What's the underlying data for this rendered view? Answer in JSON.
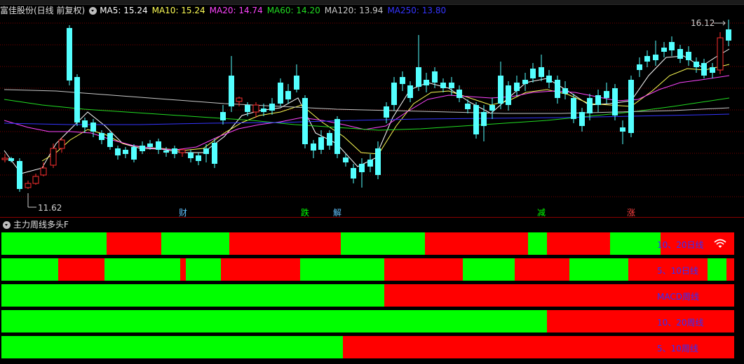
{
  "main_header": {
    "stock_name": "富佳股份(日线 前复权)",
    "ma5": "MA5: 15.24",
    "ma10": "MA10: 15.24",
    "ma20": "MA20: 14.74",
    "ma60": "MA60: 14.20",
    "ma120": "MA120: 13.94",
    "ma250": "MA250: 13.80"
  },
  "colors": {
    "up": "#ff3030",
    "down": "#54ffff",
    "ma5": "#ffffff",
    "ma10": "#ffff55",
    "ma20": "#ff44ff",
    "ma60": "#22dd22",
    "ma120": "#c8c8c8",
    "ma250": "#3535ff",
    "bar_green": "#00ff00",
    "bar_red": "#ff0000",
    "label_blue": "#3030ff",
    "grid": "#7a0000"
  },
  "price_labels": {
    "high": "16.12",
    "low": "11.62"
  },
  "annotations": [
    {
      "text": "财",
      "color": "#5fc3ff"
    },
    {
      "text": "跌",
      "color": "#00ff00"
    },
    {
      "text": "解",
      "color": "#5fc3ff"
    },
    {
      "text": "减",
      "color": "#00ff00"
    },
    {
      "text": "涨",
      "color": "#ff4040"
    }
  ],
  "indicator": {
    "title": "主力周线多头F",
    "rows": [
      {
        "label": "10、20日线",
        "segments": [
          {
            "color": "green",
            "from": 0,
            "to": 150
          },
          {
            "color": "red",
            "from": 150,
            "to": 228
          },
          {
            "color": "green",
            "from": 228,
            "to": 325
          },
          {
            "color": "red",
            "from": 325,
            "to": 484
          },
          {
            "color": "green",
            "from": 484,
            "to": 604
          },
          {
            "color": "red",
            "from": 604,
            "to": 751
          },
          {
            "color": "green",
            "from": 751,
            "to": 778
          },
          {
            "color": "red",
            "from": 778,
            "to": 868
          },
          {
            "color": "green",
            "from": 868,
            "to": 940
          },
          {
            "color": "red",
            "from": 940,
            "to": 1045
          }
        ]
      },
      {
        "label": "5、10日线",
        "segments": [
          {
            "color": "green",
            "from": 0,
            "to": 81
          },
          {
            "color": "red",
            "from": 81,
            "to": 147
          },
          {
            "color": "green",
            "from": 147,
            "to": 255
          },
          {
            "color": "red",
            "from": 255,
            "to": 263
          },
          {
            "color": "green",
            "from": 263,
            "to": 313
          },
          {
            "color": "red",
            "from": 313,
            "to": 426
          },
          {
            "color": "green",
            "from": 426,
            "to": 546
          },
          {
            "color": "red",
            "from": 546,
            "to": 658
          },
          {
            "color": "green",
            "from": 658,
            "to": 732
          },
          {
            "color": "red",
            "from": 732,
            "to": 810
          },
          {
            "color": "green",
            "from": 810,
            "to": 894
          },
          {
            "color": "red",
            "from": 894,
            "to": 1007
          },
          {
            "color": "green",
            "from": 1007,
            "to": 1034
          },
          {
            "color": "red",
            "from": 1034,
            "to": 1045
          }
        ]
      },
      {
        "label": "MACD周线",
        "segments": [
          {
            "color": "green",
            "from": 0,
            "to": 546
          },
          {
            "color": "red",
            "from": 546,
            "to": 1045
          }
        ]
      },
      {
        "label": "10、20周线",
        "segments": [
          {
            "color": "green",
            "from": 0,
            "to": 778
          },
          {
            "color": "red",
            "from": 778,
            "to": 1045
          }
        ]
      },
      {
        "label": "5、10周线",
        "segments": [
          {
            "color": "green",
            "from": 0,
            "to": 487
          },
          {
            "color": "red",
            "from": 487,
            "to": 1045
          }
        ]
      }
    ]
  }
}
